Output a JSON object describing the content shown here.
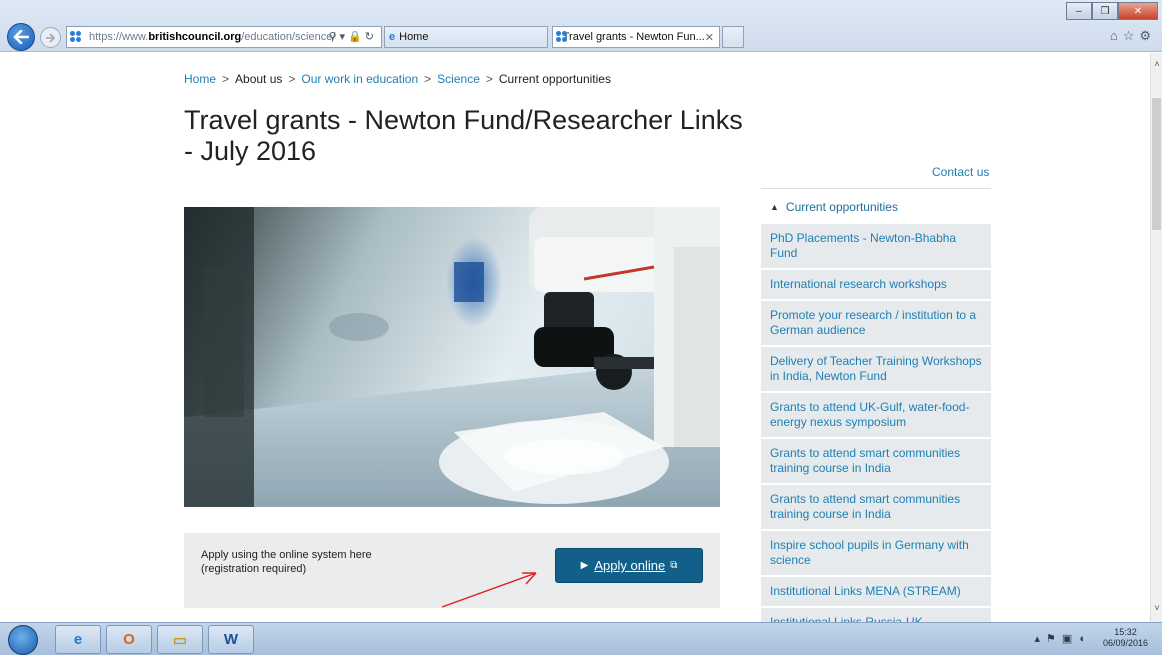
{
  "browser": {
    "url_scheme": "https://",
    "url_prefix": "www.",
    "url_domain": "britishcouncil.org",
    "url_path": "/education/science/",
    "tabs": [
      {
        "label": "Home"
      },
      {
        "label": "Travel grants - Newton Fun..."
      }
    ]
  },
  "breadcrumb": [
    {
      "label": "Home",
      "link": true
    },
    {
      "label": "About us",
      "link": false
    },
    {
      "label": "Our work in education",
      "link": true
    },
    {
      "label": "Science",
      "link": true
    },
    {
      "label": "Current opportunities",
      "link": false
    }
  ],
  "breadcrumb_separator": ">",
  "page": {
    "title": "Travel grants - Newton Fund/Researcher Links - July 2016"
  },
  "apply": {
    "text_line1": "Apply using the online system here",
    "text_line2": "(registration required)",
    "button_label": "Apply online"
  },
  "sidebar": {
    "contact": "Contact us",
    "heading": "Current opportunities",
    "items": [
      {
        "label": "PhD Placements - Newton-Bhabha Fund"
      },
      {
        "label": "International research workshops"
      },
      {
        "label": "Promote your research / institution to a German audience"
      },
      {
        "label": "Delivery of Teacher Training Workshops in India, Newton Fund"
      },
      {
        "label": "Grants to attend UK-Gulf, water-food-energy nexus symposium"
      },
      {
        "label": "Grants to attend smart communities training course in India"
      },
      {
        "label": "Grants to attend smart communities training course in India"
      },
      {
        "label": "Inspire school pupils in Germany with science"
      },
      {
        "label": "Institutional Links MENA (STREAM)"
      },
      {
        "label": "Institutional Links Russia-UK"
      }
    ]
  },
  "taskbar": {
    "time": "15:32",
    "date": "06/09/2016"
  },
  "colors": {
    "link": "#1e7fb5",
    "button": "#12608a",
    "sidebar_item_bg": "#e6eaec",
    "annotation_arrow": "#e02020"
  }
}
